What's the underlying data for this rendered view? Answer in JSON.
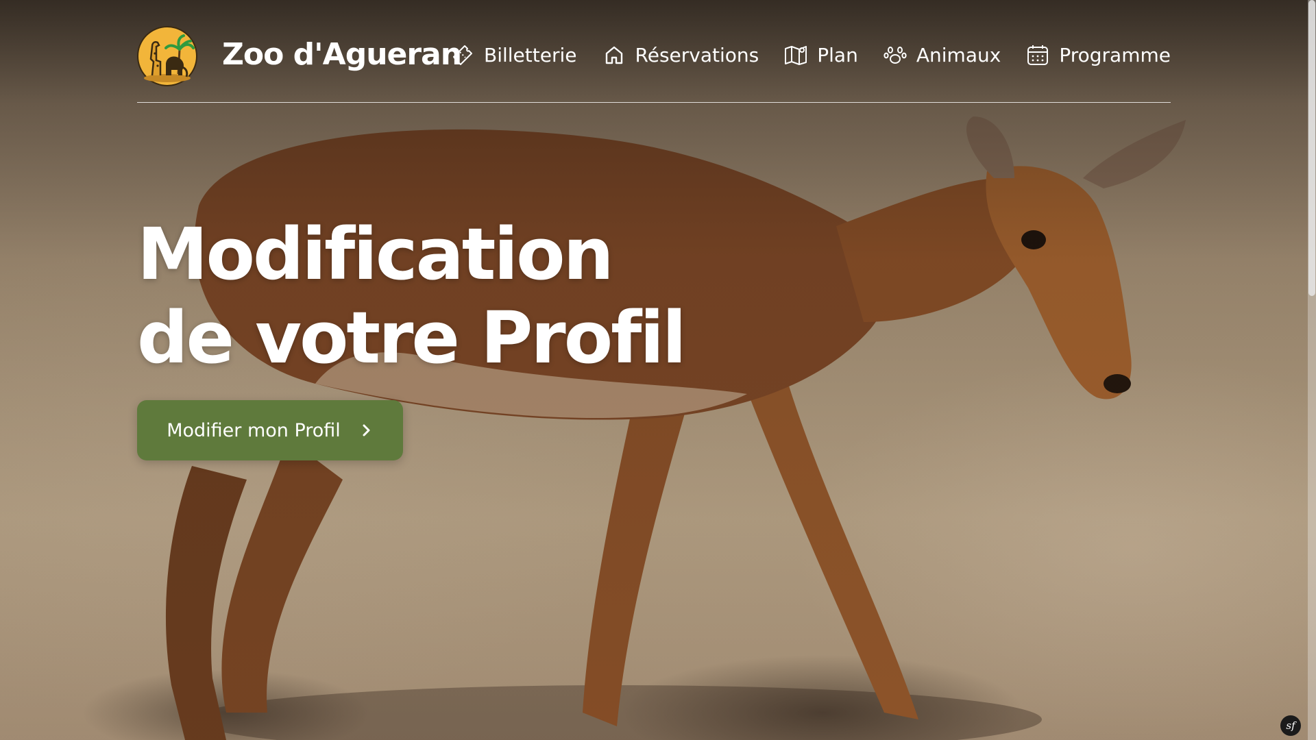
{
  "header": {
    "brand": "Zoo d'Agueran",
    "logo_icon": "giraffe-elephant-palm-logo",
    "nav": [
      {
        "label": "Billetterie",
        "icon": "ticket-icon"
      },
      {
        "label": "Réservations",
        "icon": "home-icon"
      },
      {
        "label": "Plan",
        "icon": "map-icon"
      },
      {
        "label": "Animaux",
        "icon": "paw-icon"
      },
      {
        "label": "Programme",
        "icon": "calendar-icon"
      }
    ]
  },
  "hero": {
    "title_line1": "Modification",
    "title_line2": "de votre Profil",
    "cta_label": "Modifier mon Profil",
    "cta_icon": "chevron-right-icon",
    "background": "impala-photo"
  },
  "debug_toolbar": {
    "label": "sf"
  },
  "colors": {
    "accent": "#5f7a3c",
    "text": "#ffffff",
    "logo_gold": "#f2b53a"
  }
}
